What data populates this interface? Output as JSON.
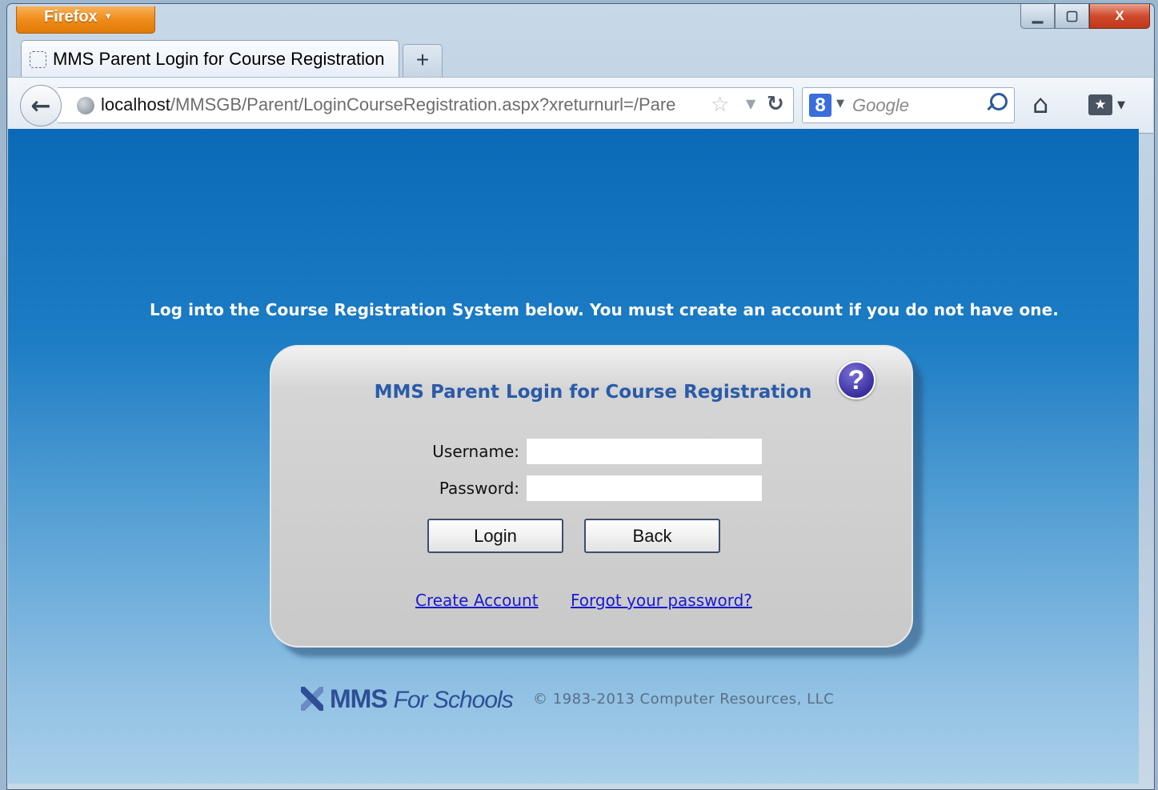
{
  "browser": {
    "app_button_label": "Firefox",
    "tab": {
      "title": "MMS Parent Login for Course Registration"
    },
    "new_tab_label": "+",
    "url": {
      "host": "localhost",
      "path": "/MMSGB/Parent/LoginCourseRegistration.aspx?xreturnurl=/Pare"
    },
    "search": {
      "engine_letter": "8",
      "placeholder": "Google"
    },
    "window_controls": {
      "minimize": "▁",
      "maximize": "▢",
      "close": "X"
    }
  },
  "page": {
    "instruction": "Log into the Course Registration System below. You must create an account if you do not have one.",
    "login_panel": {
      "title": "MMS Parent Login for Course Registration",
      "help_label": "?",
      "username_label": "Username:",
      "password_label": "Password:",
      "username_value": "",
      "password_value": "",
      "login_button": "Login",
      "back_button": "Back",
      "create_account_link": "Create Account",
      "forgot_password_link": "Forgot your password?"
    },
    "footer": {
      "logo_mms": "MMS",
      "logo_for_schools": "For Schools",
      "copyright": "© 1983-2013 Computer Resources, LLC"
    }
  },
  "colors": {
    "content_gradient_top": "#0a6ab7",
    "content_gradient_bottom": "#a9cfe9",
    "panel_title": "#2a5ba8",
    "link": "#1a1ad2",
    "firefox_orange": "#ef8c19"
  },
  "icons": {
    "tab_favicon": "dashed-square-icon",
    "back": "back-arrow-icon",
    "site": "globe-icon",
    "bookmark_star": "star-icon",
    "reload": "reload-icon",
    "search_engine": "google-plus-icon",
    "search": "magnifier-icon",
    "home": "home-icon",
    "bookmarks": "bookmarks-icon",
    "help": "help-icon"
  }
}
